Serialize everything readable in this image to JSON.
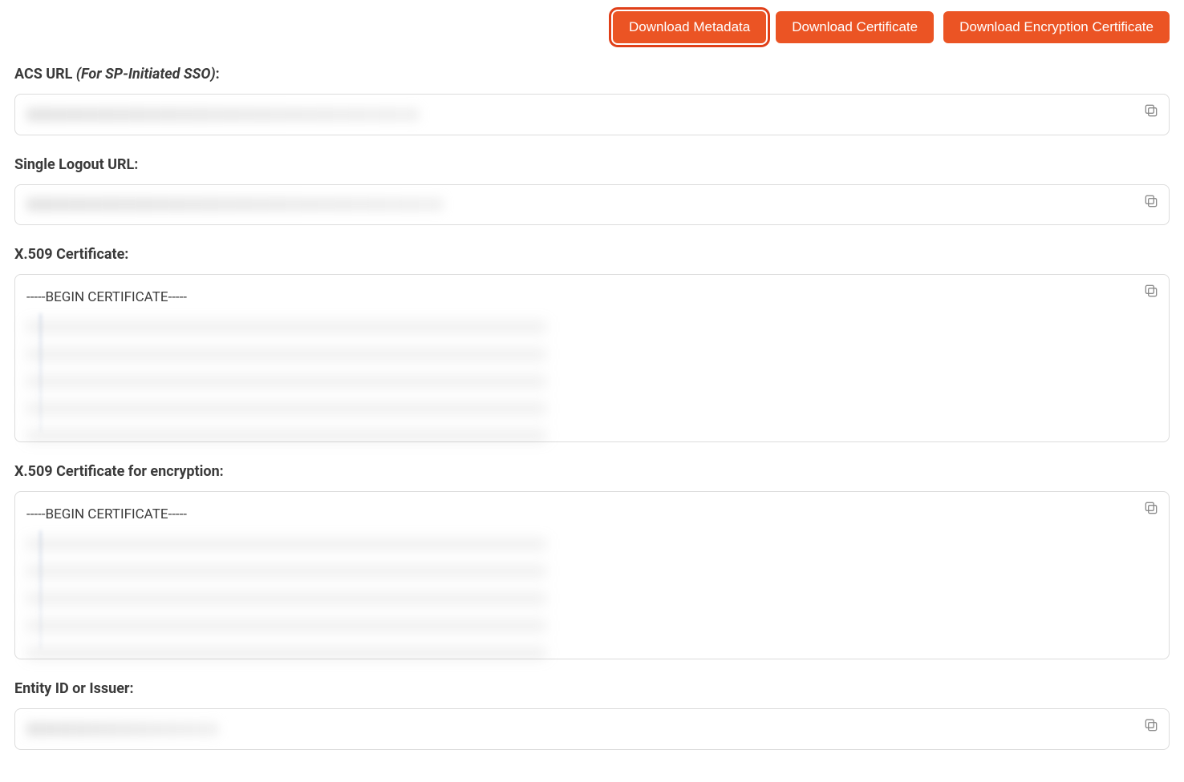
{
  "buttons": {
    "download_metadata": "Download Metadata",
    "download_certificate": "Download Certificate",
    "download_encryption_certificate": "Download Encryption Certificate"
  },
  "labels": {
    "acs_url_prefix": "ACS URL ",
    "acs_url_italic": "(For SP-Initiated SSO)",
    "acs_url_suffix": ":",
    "single_logout_url": "Single Logout URL:",
    "x509_certificate": "X.509 Certificate:",
    "x509_certificate_encryption": "X.509 Certificate for encryption:",
    "entity_id": "Entity ID or Issuer:"
  },
  "values": {
    "acs_url": "",
    "single_logout_url": "",
    "x509_certificate_header": "-----BEGIN CERTIFICATE-----",
    "x509_certificate_body": "",
    "x509_certificate_encryption_header": "-----BEGIN CERTIFICATE-----",
    "x509_certificate_encryption_body": "",
    "entity_id": ""
  },
  "icons": {
    "copy": "copy-icon"
  },
  "colors": {
    "accent": "#eb5424",
    "highlight_border": "#e03f18"
  }
}
